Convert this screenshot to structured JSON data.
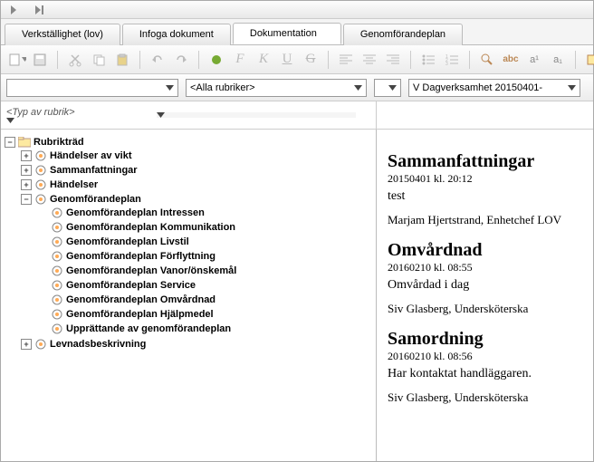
{
  "topbar": {},
  "tabs": {
    "t0": "Verkställighet (lov)",
    "t1": "Infoga dokument",
    "t2": "Dokumentation",
    "t3": "Genomförandeplan"
  },
  "filter": {
    "combo1_placeholder": "",
    "combo2_value": "<Alla rubriker>",
    "combo3_value": "",
    "combo4_value": "V Dagverksamhet 20150401-"
  },
  "filter2": {
    "type_value": "<Typ av rubrik>",
    "combo_value": ""
  },
  "tree": {
    "root": "Rubrikträd",
    "n1": "Händelser av vikt",
    "n2": "Sammanfattningar",
    "n3": "Händelser",
    "n4": "Genomförandeplan",
    "n4_1": "Genomförandeplan  Intressen",
    "n4_2": "Genomförandeplan Kommunikation",
    "n4_3": "Genomförandeplan  Livstil",
    "n4_4": "Genomförandeplan Förflyttning",
    "n4_5": "Genomförandeplan Vanor/önskemål",
    "n4_6": "Genomförandeplan  Service",
    "n4_7": "Genomförandeplan Omvårdnad",
    "n4_8": "Genomförandeplan Hjälpmedel",
    "n4_9": "Upprättande av genomförandeplan",
    "n5": "Levnadsbeskrivning"
  },
  "doc": {
    "e1": {
      "title": "Sammanfattningar",
      "meta": "20150401 kl. 20:12",
      "body": "test",
      "author": "Marjam Hjertstrand, Enhetchef LOV"
    },
    "e2": {
      "title": "Omvårdnad",
      "meta": "20160210 kl. 08:55",
      "body": "Omvårdad i dag",
      "author": "Siv Glasberg, Undersköterska"
    },
    "e3": {
      "title": "Samordning",
      "meta": "20160210 kl. 08:56",
      "body": "Har kontaktat handläggaren.",
      "author": "Siv Glasberg, Undersköterska"
    }
  }
}
